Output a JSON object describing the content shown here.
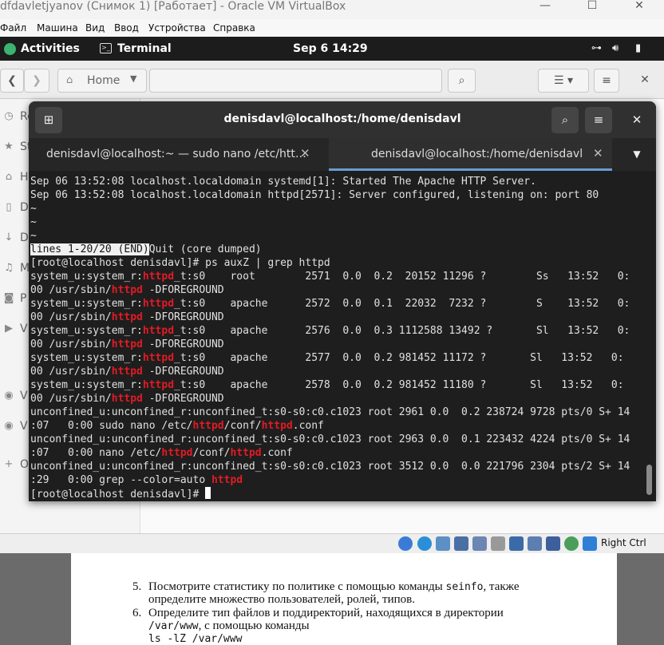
{
  "host_window": {
    "title": "dfdavletjyanov (Снимок 1) [Работает] - Oracle VM VirtualBox",
    "minimize_glyph": "—",
    "maximize_glyph": "☐",
    "close_glyph": "✕"
  },
  "vbox_menu": [
    "Файл",
    "Машина",
    "Вид",
    "Ввод",
    "Устройства",
    "Справка"
  ],
  "gnome_topbar": {
    "activities": "Activities",
    "app_name": "Terminal",
    "clock": "Sep 6  14:29"
  },
  "files": {
    "back_glyph": "❮",
    "forward_glyph": "❯",
    "path_label": "Home",
    "search_glyph": "⌕",
    "sidebar": [
      {
        "label": "Re",
        "icon": "clock-icon"
      },
      {
        "label": "St",
        "icon": "star-icon"
      },
      {
        "label": "H",
        "icon": "home-icon"
      },
      {
        "label": "D",
        "icon": "document-icon"
      },
      {
        "label": "D",
        "icon": "download-icon"
      },
      {
        "label": "M",
        "icon": "music-icon"
      },
      {
        "label": "P",
        "icon": "camera-icon"
      },
      {
        "label": "V",
        "icon": "video-icon"
      },
      {
        "label": "V",
        "icon": "disc-icon"
      },
      {
        "label": "V",
        "icon": "disc-icon"
      },
      {
        "label": "O",
        "icon": "plus-icon"
      }
    ]
  },
  "terminal": {
    "window_title": "denisdavl@localhost:/home/denisdavl",
    "tabs": [
      {
        "label": "denisdavl@localhost:~ — sudo nano /etc/htt…",
        "close": "✕"
      },
      {
        "label": "denisdavl@localhost:/home/denisdavl",
        "close": "✕"
      }
    ],
    "lines": [
      [
        {
          "t": "Sep 06 13:52:08 localhost.localdomain systemd[1]: Started The Apache HTTP Server."
        }
      ],
      [
        {
          "t": "Sep 06 13:52:08 localhost.localdomain httpd[2571]: Server configured, listening on: port 80"
        }
      ],
      [
        {
          "t": "~"
        }
      ],
      [
        {
          "t": "~"
        }
      ],
      [
        {
          "t": "~"
        }
      ],
      [
        {
          "t": "lines 1-20/20 (END)",
          "c": "hl"
        },
        {
          "t": "Quit (core dumped)"
        }
      ],
      [
        {
          "t": "[root@localhost denisdavl]# ps auxZ | grep httpd"
        }
      ],
      [
        {
          "t": "system_u:system_r:"
        },
        {
          "t": "httpd",
          "c": "r"
        },
        {
          "t": "_t:s0    root        2571  0.0  0.2  20152 11296 ?        Ss   13:52   0:"
        }
      ],
      [
        {
          "t": "00 /usr/sbin/"
        },
        {
          "t": "httpd",
          "c": "r"
        },
        {
          "t": " -DFOREGROUND"
        }
      ],
      [
        {
          "t": "system_u:system_r:"
        },
        {
          "t": "httpd",
          "c": "r"
        },
        {
          "t": "_t:s0    apache      2572  0.0  0.1  22032  7232 ?        S    13:52   0:"
        }
      ],
      [
        {
          "t": "00 /usr/sbin/"
        },
        {
          "t": "httpd",
          "c": "r"
        },
        {
          "t": " -DFOREGROUND"
        }
      ],
      [
        {
          "t": "system_u:system_r:"
        },
        {
          "t": "httpd",
          "c": "r"
        },
        {
          "t": "_t:s0    apache      2576  0.0  0.3 1112588 13492 ?       Sl   13:52   0:"
        }
      ],
      [
        {
          "t": "00 /usr/sbin/"
        },
        {
          "t": "httpd",
          "c": "r"
        },
        {
          "t": " -DFOREGROUND"
        }
      ],
      [
        {
          "t": "system_u:system_r:"
        },
        {
          "t": "httpd",
          "c": "r"
        },
        {
          "t": "_t:s0    apache      2577  0.0  0.2 981452 11172 ?       Sl   13:52   0:"
        }
      ],
      [
        {
          "t": "00 /usr/sbin/"
        },
        {
          "t": "httpd",
          "c": "r"
        },
        {
          "t": " -DFOREGROUND"
        }
      ],
      [
        {
          "t": "system_u:system_r:"
        },
        {
          "t": "httpd",
          "c": "r"
        },
        {
          "t": "_t:s0    apache      2578  0.0  0.2 981452 11180 ?       Sl   13:52   0:"
        }
      ],
      [
        {
          "t": "00 /usr/sbin/"
        },
        {
          "t": "httpd",
          "c": "r"
        },
        {
          "t": " -DFOREGROUND"
        }
      ],
      [
        {
          "t": "unconfined_u:unconfined_r:unconfined_t:s0-s0:c0.c1023 root 2961 0.0  0.2 238724 9728 pts/0 S+ 14"
        }
      ],
      [
        {
          "t": ":07   0:00 sudo nano /etc/"
        },
        {
          "t": "httpd",
          "c": "r"
        },
        {
          "t": "/conf/"
        },
        {
          "t": "httpd",
          "c": "r"
        },
        {
          "t": ".conf"
        }
      ],
      [
        {
          "t": "unconfined_u:unconfined_r:unconfined_t:s0-s0:c0.c1023 root 2963 0.0  0.1 223432 4224 pts/0 S+ 14"
        }
      ],
      [
        {
          "t": ":07   0:00 nano /etc/"
        },
        {
          "t": "httpd",
          "c": "r"
        },
        {
          "t": "/conf/"
        },
        {
          "t": "httpd",
          "c": "r"
        },
        {
          "t": ".conf"
        }
      ],
      [
        {
          "t": "unconfined_u:unconfined_r:unconfined_t:s0-s0:c0.c1023 root 3512 0.0  0.0 221796 2304 pts/2 S+ 14"
        }
      ],
      [
        {
          "t": ":29   0:00 grep --color=auto "
        },
        {
          "t": "httpd",
          "c": "r"
        }
      ],
      [
        {
          "t": "[root@localhost denisdavl]# "
        },
        {
          "t": "",
          "c": "cursor"
        }
      ]
    ]
  },
  "statusbar": {
    "host_key": "Right Ctrl"
  },
  "document": {
    "item5_num": "5.",
    "item5_l1a": "Посмотрите статистику по политике с помощью команды ",
    "item5_cmd": "seinfo",
    "item5_l1b": ", также",
    "item5_l2": "определите множество пользователей, ролей, типов.",
    "item6_num": "6.",
    "item6_l1": "Определите тип файлов и поддиректорий, находящихся в директории",
    "item6_path": "/var/www",
    "item6_l2b": ", с помощью команды",
    "item6_cmd": "ls -lZ /var/www"
  }
}
